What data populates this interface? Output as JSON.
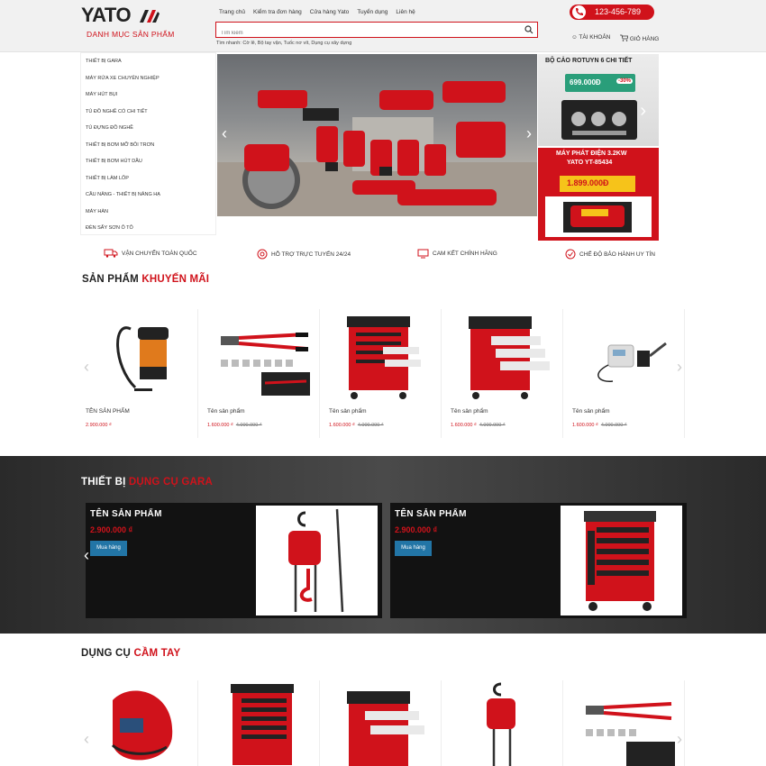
{
  "header": {
    "logo": "YATO",
    "category_title": "DANH MỤC SẢN PHẨM",
    "nav": [
      "Trang chủ",
      "Kiểm tra đơn hàng",
      "Cửa hàng Yato",
      "Tuyển dụng",
      "Liên hệ"
    ],
    "search_placeholder": "Tìm kiếm",
    "hot_search": "Tìm nhanh: Cờ lê, Bộ tay vặn, Tuốc nơ vít, Dụng cụ xây dựng",
    "phone": "123-456-789",
    "account": "TÀI KHOẢN",
    "cart": "GIỎ HÀNG"
  },
  "categories": [
    "Thiết bị gara",
    "Máy rửa xe chuyên nghiệp",
    "Máy hút bụi",
    "Tủ đồ nghề có chi tiết",
    "Tủ đựng đồ nghề",
    "Thiết bị bơm mỡ bôi trơn",
    "Thiết bị bơm hút dầu",
    "Thiết bị làm lốp",
    "Cầu nâng - Thiết bị nâng hạ",
    "Máy hàn",
    "Đèn sấy sơn ô tô"
  ],
  "side_banners": {
    "top_title": "BỘ CẢO ROTUYN 6 CHI TIẾT",
    "top_price": "699.000Đ",
    "top_discount": "-30%",
    "bottom_title_1": "MÁY PHÁT ĐIỆN 3.2KW",
    "bottom_title_2": "YATO YT-85434",
    "bottom_price": "1.899.000Đ"
  },
  "features": [
    {
      "label": "VẬN CHUYỂN TOÀN QUỐC",
      "icon": "truck-icon"
    },
    {
      "label": "HỖ TRỢ TRỰC TUYẾN 24/24",
      "icon": "support-icon"
    },
    {
      "label": "CAM KẾT CHÍNH HÃNG",
      "icon": "genuine-icon"
    },
    {
      "label": "CHẾ ĐỘ BẢO HÀNH UY TÍN",
      "icon": "warranty-icon"
    }
  ],
  "promo": {
    "title_plain": "SẢN PHẨM",
    "title_highlight": "KHUYẾN MÃI",
    "products": [
      {
        "name": "TÊN SẢN PHẨM",
        "price": "2.900.000 ₫",
        "old_price": ""
      },
      {
        "name": "Tên sản phẩm",
        "price": "1.600.000 ₫",
        "old_price": "4.000.000 ₫"
      },
      {
        "name": "Tên sản phẩm",
        "price": "1.600.000 ₫",
        "old_price": "4.000.000 ₫"
      },
      {
        "name": "Tên sản phẩm",
        "price": "1.600.000 ₫",
        "old_price": "4.000.000 ₫"
      },
      {
        "name": "Tên sản phẩm",
        "price": "1.600.000 ₫",
        "old_price": "4.000.000 ₫"
      }
    ]
  },
  "gara": {
    "title_plain": "THIẾT BỊ",
    "title_highlight": "DỤNG CỤ GARA",
    "products": [
      {
        "name": "TÊN SẢN PHẨM",
        "price": "2.900.000 ₫",
        "buy": "Mua hàng"
      },
      {
        "name": "TÊN SẢN PHẨM",
        "price": "2.900.000 ₫",
        "buy": "Mua hàng"
      }
    ]
  },
  "hand": {
    "title_plain": "DỤNG CỤ",
    "title_highlight": "CẦM TAY"
  },
  "colors": {
    "brand_red": "#d0121b",
    "buy_blue": "#2275a6"
  }
}
